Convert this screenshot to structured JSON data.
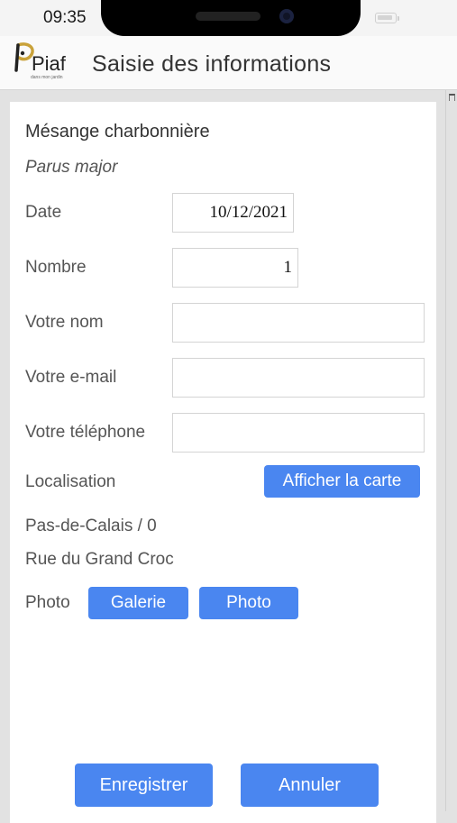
{
  "status_bar": {
    "time": "09:35"
  },
  "app_bar": {
    "logo_text": "Piaf",
    "logo_subtext": "dans mon jardin",
    "title": "Saisie des informations"
  },
  "form": {
    "species_common": "Mésange charbonnière",
    "species_latin": "Parus major",
    "date_label": "Date",
    "date_value": "10/12/2021",
    "count_label": "Nombre",
    "count_value": "1",
    "name_label": "Votre nom",
    "name_value": "",
    "email_label": "Votre e-mail",
    "email_value": "",
    "phone_label": "Votre téléphone",
    "phone_value": "",
    "location_label": "Localisation",
    "map_button_label": "Afficher la carte",
    "region": "Pas-de-Calais / 0",
    "street": "Rue du Grand Croc",
    "photo_label": "Photo",
    "gallery_button_label": "Galerie",
    "photo_button_label": "Photo"
  },
  "actions": {
    "save_label": "Enregistrer",
    "cancel_label": "Annuler"
  },
  "colors": {
    "primary_button": "#4a86f0",
    "background": "#e2e2e2"
  }
}
